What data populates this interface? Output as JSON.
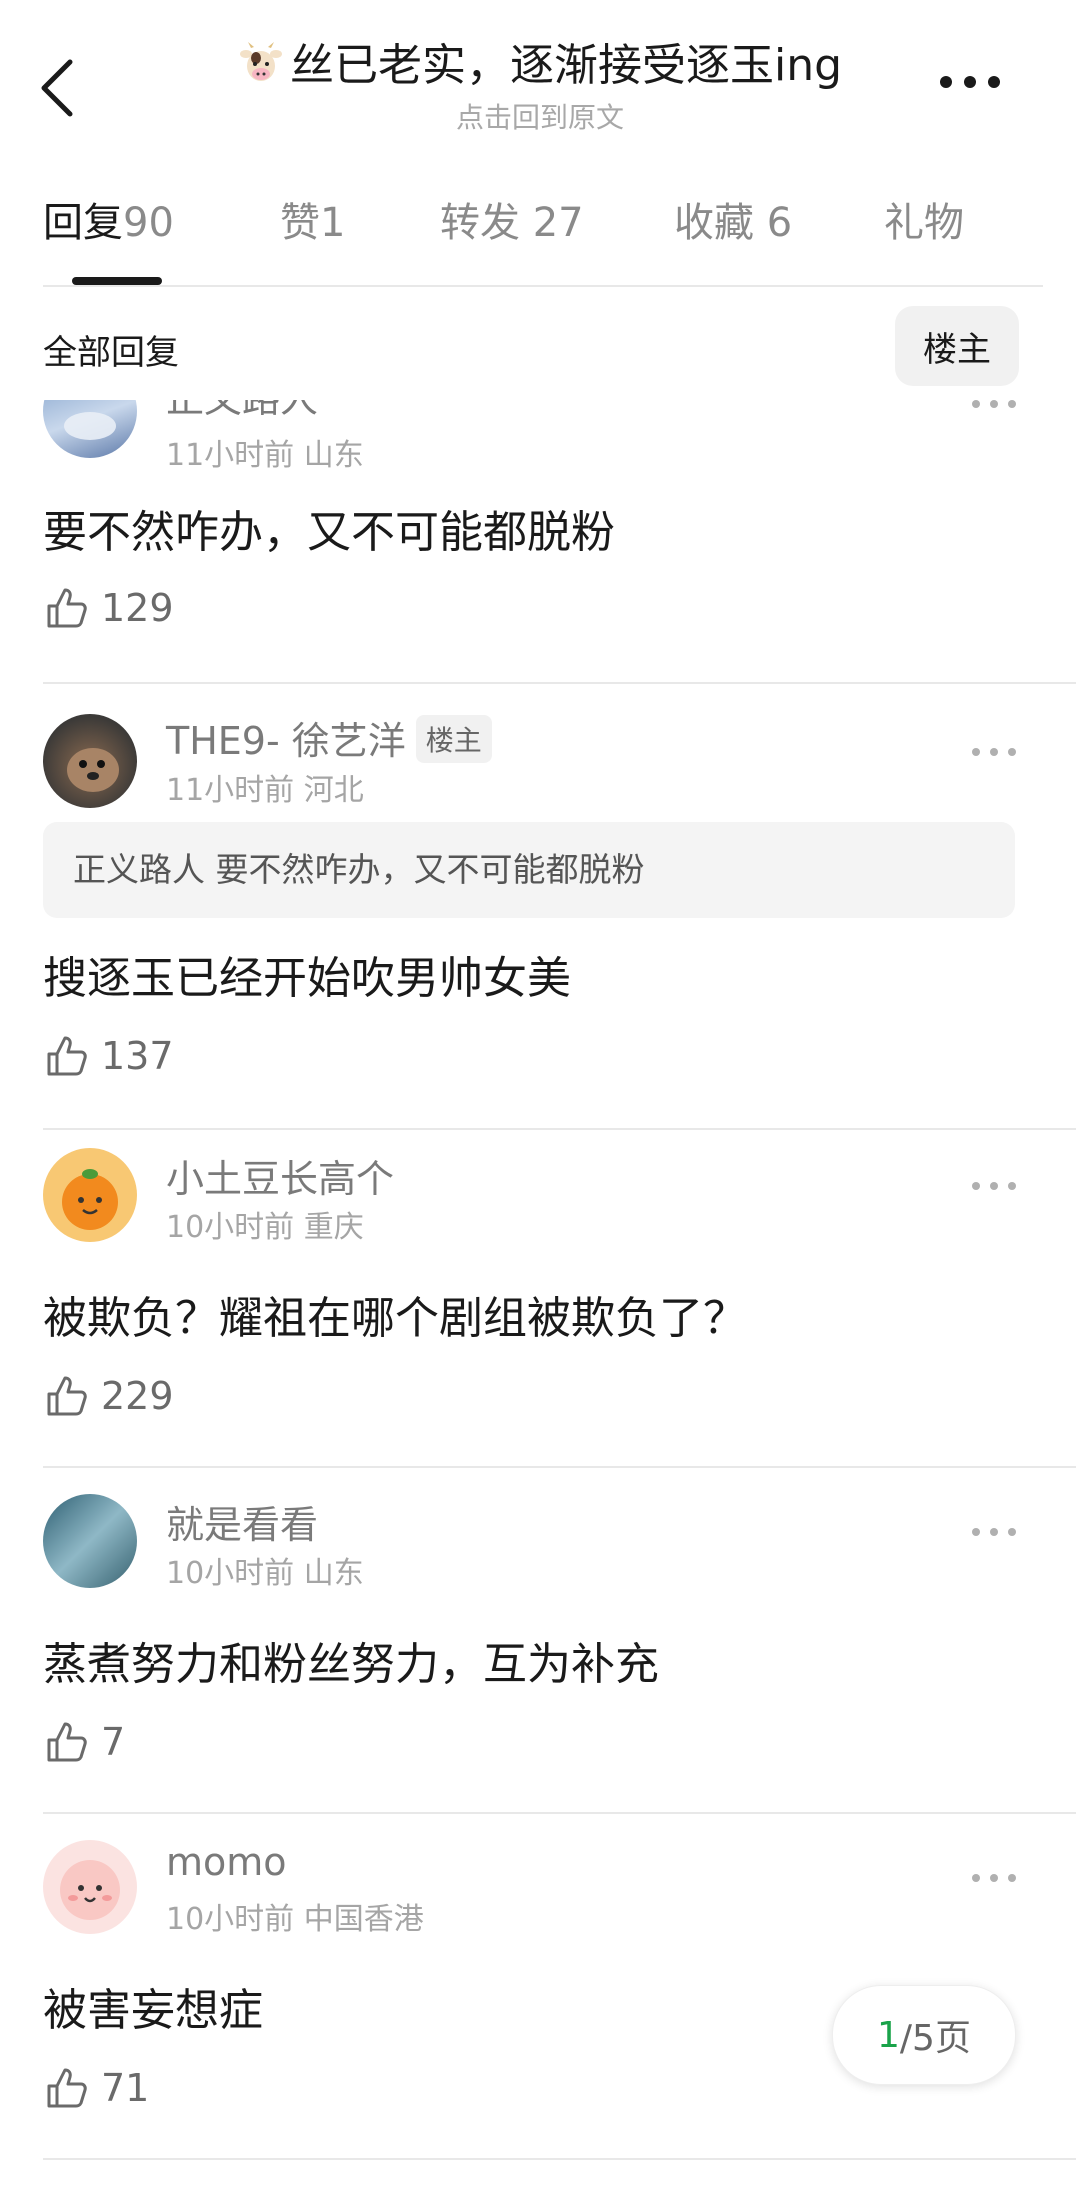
{
  "header": {
    "title": "丝已老实，逐渐接受逐玉ing",
    "subtitle": "点击回到原文",
    "title_emoji": "cow-face"
  },
  "tabs": [
    {
      "label": "回复",
      "count": "90",
      "active": true
    },
    {
      "label": "赞",
      "count": "1",
      "active": false
    },
    {
      "label": "转发",
      "count": "27",
      "active": false
    },
    {
      "label": "收藏",
      "count": "6",
      "active": false
    },
    {
      "label": "礼物",
      "count": "",
      "active": false
    }
  ],
  "filter": {
    "label": "全部回复",
    "op_button": "楼主"
  },
  "comments": [
    {
      "username": "正义路人",
      "badge": "",
      "time": "11小时前",
      "location": "山东",
      "quote": "",
      "text": "要不然咋办，又不可能都脱粉",
      "likes": "129"
    },
    {
      "username": "THE9- 徐艺洋",
      "badge": "楼主",
      "time": "11小时前",
      "location": "河北",
      "quote": "正义路人 要不然咋办，又不可能都脱粉",
      "text": "搜逐玉已经开始吹男帅女美",
      "likes": "137"
    },
    {
      "username": "小土豆长高个",
      "badge": "",
      "time": "10小时前",
      "location": "重庆",
      "quote": "",
      "text": "被欺负？耀祖在哪个剧组被欺负了？",
      "likes": "229"
    },
    {
      "username": "就是看看",
      "badge": "",
      "time": "10小时前",
      "location": "山东",
      "quote": "",
      "text": "蒸煮努力和粉丝努力，互为补充",
      "likes": "7"
    },
    {
      "username": "momo",
      "badge": "",
      "time": "10小时前",
      "location": "中国香港",
      "quote": "",
      "text": "被害妄想症",
      "likes": "71"
    }
  ],
  "pager": {
    "current": "1",
    "rest": "/5页"
  },
  "colors": {
    "accent_green": "#1aa34a",
    "text_primary": "#1a1a1a",
    "text_secondary": "#a5a5a5"
  }
}
